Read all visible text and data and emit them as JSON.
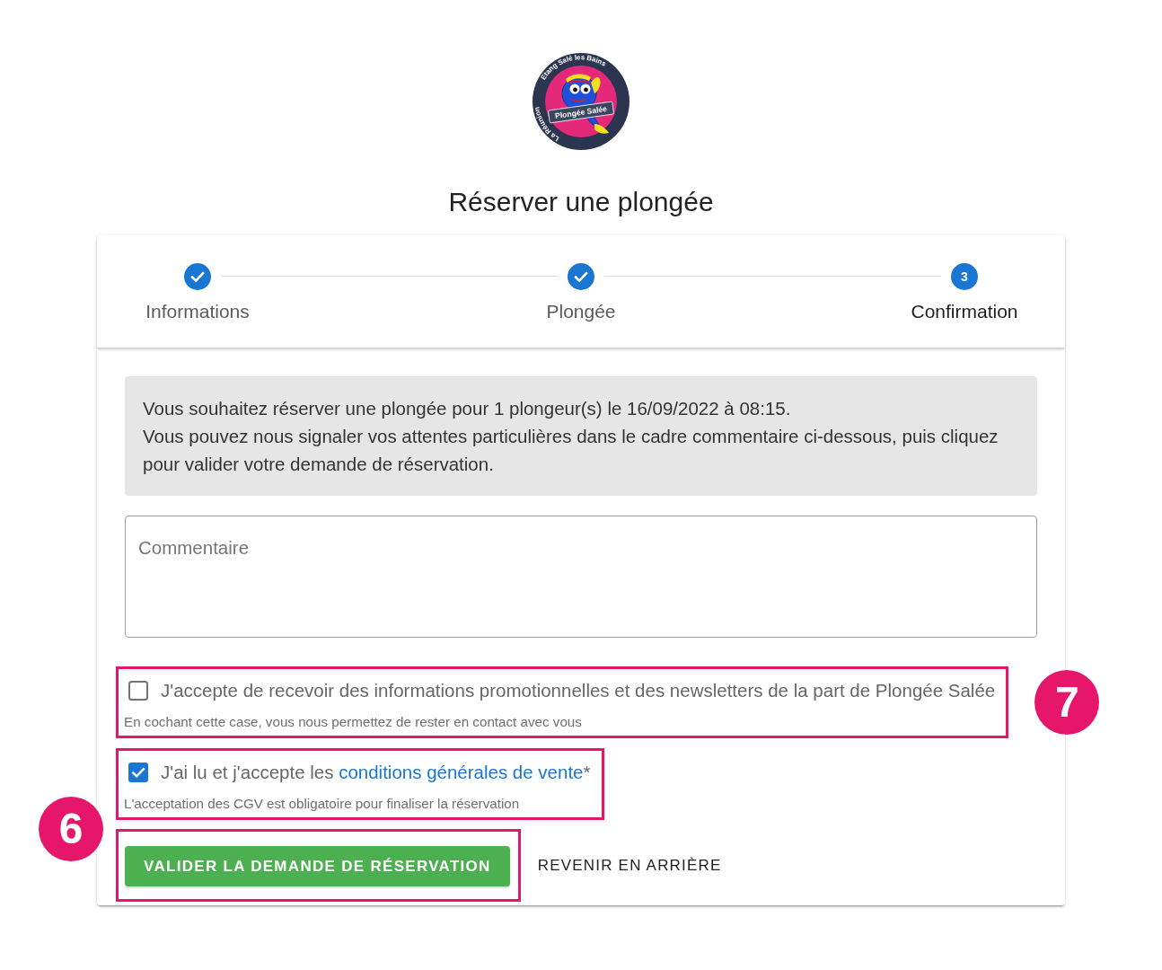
{
  "logo": {
    "ring_left": "La Réunion",
    "ring_top": "Etang Salé les Bains",
    "banner": "Plongée Salée"
  },
  "title": "Réserver une plongée",
  "stepper": [
    {
      "label": "Informations",
      "completed": true,
      "selected": false
    },
    {
      "label": "Plongée",
      "completed": true,
      "selected": false
    },
    {
      "label": "Confirmation",
      "number": "3",
      "completed": false,
      "selected": true
    }
  ],
  "summary": [
    "Vous souhaitez réserver une plongée pour 1 plongeur(s) le 16/09/2022 à 08:15.",
    "Vous pouvez nous signaler vos attentes particulières dans le cadre commentaire ci-dessous, puis cliquez pour valider votre demande de réservation."
  ],
  "comment": {
    "placeholder": "Commentaire"
  },
  "checkboxes": [
    {
      "label": "J'accepte de recevoir des informations promotionnelles et des newsletters de la part de Plongée Salée",
      "hint": "En cochant cette case, vous nous permettez de rester en contact avec vous",
      "checked": false,
      "highlighted": true,
      "callout": "7"
    },
    {
      "label": "J'ai lu et j'accepte les ",
      "link": "conditions générales de vente",
      "label_end": "*",
      "hint": "L'acceptation des CGV est obligatoire pour finaliser la réservation",
      "checked": true,
      "highlighted": true
    }
  ],
  "buttons": [
    {
      "label": "VALIDER LA DEMANDE DE RÉSERVATION",
      "kind": "primary",
      "highlighted": true,
      "callout": "6"
    },
    {
      "label": "REVENIR EN ARRIÈRE",
      "kind": "text",
      "highlighted": false
    }
  ]
}
